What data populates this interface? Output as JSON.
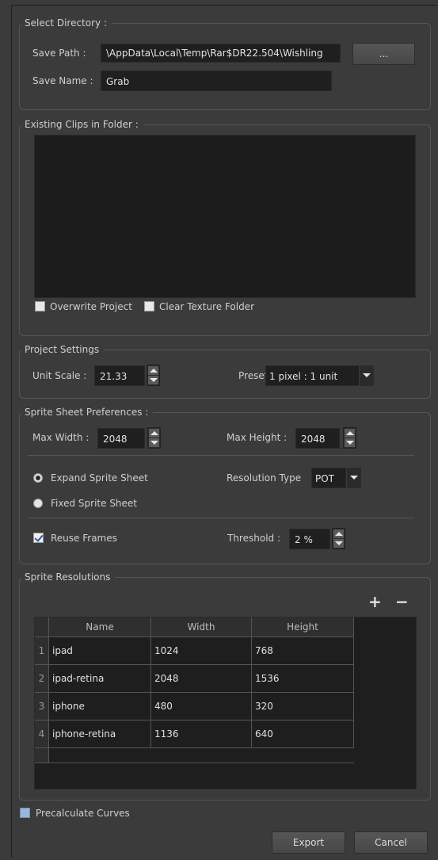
{
  "select_directory": {
    "title": "Select Directory :",
    "save_path_label": "Save Path :",
    "save_path_value": "\\AppData\\Local\\Temp\\Rar$DR22.504\\Wishling",
    "browse_label": "...",
    "save_name_label": "Save Name :",
    "save_name_value": "Grab"
  },
  "existing_clips": {
    "title": "Existing Clips in Folder :",
    "overwrite_label": "Overwrite Project",
    "overwrite_checked": false,
    "clear_texture_label": "Clear Texture Folder",
    "clear_texture_checked": false
  },
  "project_settings": {
    "title": "Project Settings",
    "unit_scale_label": "Unit Scale :",
    "unit_scale_value": "21.33",
    "preset_label": "Preset",
    "preset_value": "1 pixel : 1 unit"
  },
  "sprite_sheet": {
    "title": "Sprite Sheet Preferences :",
    "max_width_label": "Max Width :",
    "max_width_value": "2048",
    "max_height_label": "Max Height :",
    "max_height_value": "2048",
    "expand_label": "Expand Sprite Sheet",
    "expand_selected": true,
    "fixed_label": "Fixed Sprite Sheet",
    "fixed_selected": false,
    "resolution_type_label": "Resolution Type",
    "resolution_type_value": "POT",
    "reuse_frames_label": "Reuse Frames",
    "reuse_frames_checked": true,
    "threshold_label": "Threshold :",
    "threshold_value": "2 %"
  },
  "sprite_resolutions": {
    "title": "Sprite Resolutions",
    "add_label": "+",
    "remove_label": "−",
    "columns": [
      "Name",
      "Width",
      "Height"
    ],
    "rows": [
      {
        "num": "1",
        "name": "ipad",
        "width": "1024",
        "height": "768"
      },
      {
        "num": "2",
        "name": "ipad-retina",
        "width": "2048",
        "height": "1536"
      },
      {
        "num": "3",
        "name": "iphone",
        "width": "480",
        "height": "320"
      },
      {
        "num": "4",
        "name": "iphone-retina",
        "width": "1136",
        "height": "640"
      }
    ]
  },
  "footer": {
    "precalculate_label": "Precalculate Curves",
    "precalculate_checked": false,
    "export_label": "Export",
    "cancel_label": "Cancel"
  }
}
